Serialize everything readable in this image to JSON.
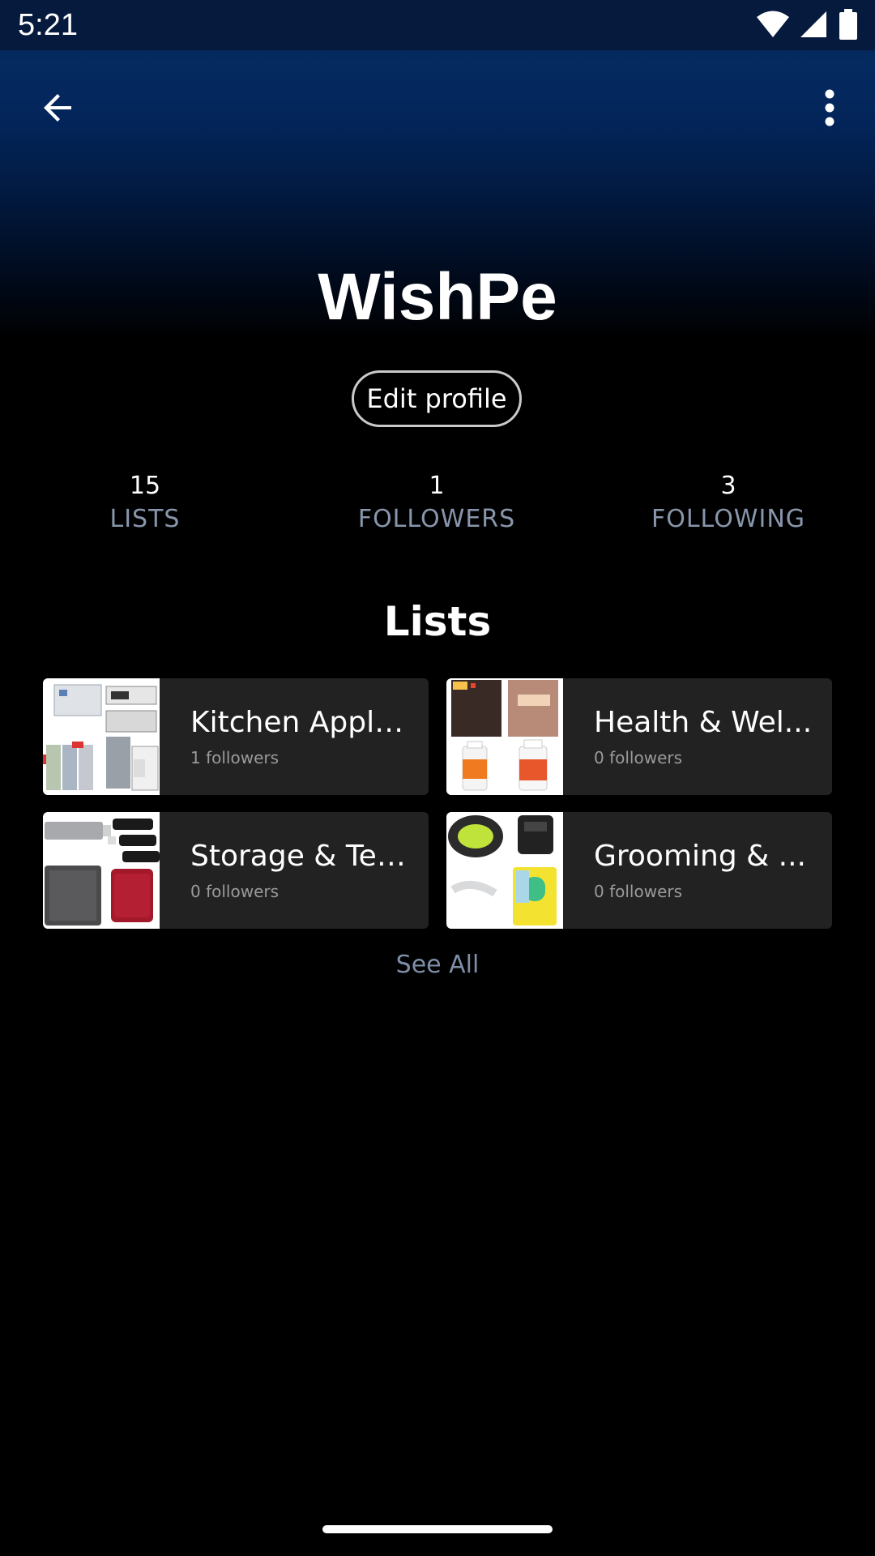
{
  "status_bar": {
    "time": "5:21"
  },
  "profile": {
    "name": "WishPe",
    "edit_label": "Edit profile"
  },
  "stats": [
    {
      "value": "15",
      "label": "LISTS"
    },
    {
      "value": "1",
      "label": "FOLLOWERS"
    },
    {
      "value": "3",
      "label": "FOLLOWING"
    }
  ],
  "lists_section": {
    "title": "Lists",
    "see_all_label": "See All",
    "items": [
      {
        "title": "Kitchen Appli...",
        "followers": "1 followers"
      },
      {
        "title": "Health & Wel...",
        "followers": "0 followers"
      },
      {
        "title": "Storage & Tech",
        "followers": "0 followers"
      },
      {
        "title": "Grooming & ...",
        "followers": "0 followers"
      }
    ]
  },
  "icons": {
    "back": "arrow-back-icon",
    "more": "more-vertical-icon",
    "wifi": "wifi-icon",
    "signal": "signal-icon",
    "battery": "battery-icon"
  },
  "colors": {
    "header_gradient_top": "#042a60",
    "card_bg": "#222222",
    "stat_label": "#8896ab",
    "link": "#7d8ea6"
  }
}
